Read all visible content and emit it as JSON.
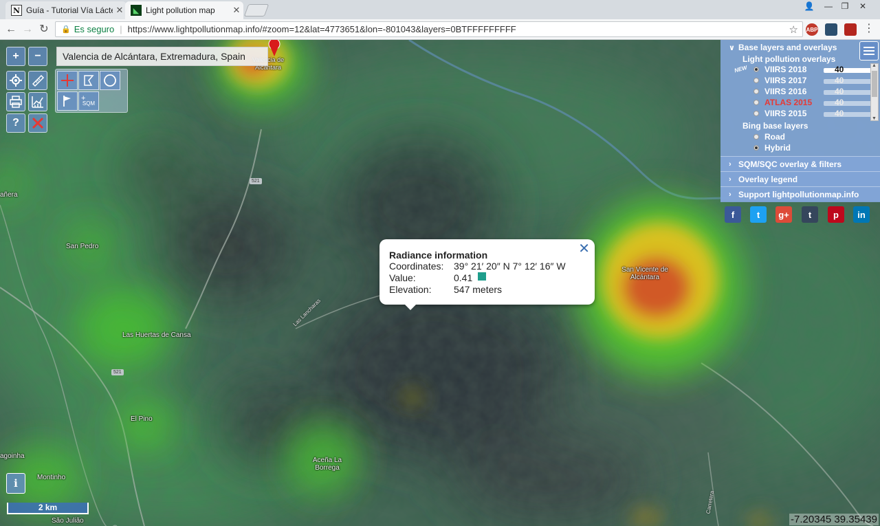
{
  "browser": {
    "tabs": [
      {
        "title": "Guía - Tutorial Vía Láctea",
        "favicon": "N"
      },
      {
        "title": "Light pollution map",
        "favicon": "lp"
      }
    ],
    "address": {
      "secure_label": "Es seguro",
      "url": "https://www.lightpollutionmap.info/#zoom=12&lat=4773651&lon=-801043&layers=0BTFFFFFFFFF"
    },
    "extensions": [
      {
        "label": "ABP",
        "color": "#c0392b"
      },
      {
        "label": "",
        "color": "#2c4f6e"
      },
      {
        "label": "",
        "color": "#b3261e"
      }
    ]
  },
  "map": {
    "search_text": "Valencia de Alcántara, Extremadura, Spain",
    "places": [
      {
        "name": "San Pedro"
      },
      {
        "name": "Las Huertas de Cansa"
      },
      {
        "name": "El Pino"
      },
      {
        "name": "Montinho"
      },
      {
        "name": "Aceña La Borrega"
      },
      {
        "name": "San Vicente de Alcántara"
      },
      {
        "name": "Las Lancharas"
      },
      {
        "name": "agoinha"
      },
      {
        "name": "añera"
      },
      {
        "name": "São Julião"
      },
      {
        "name": "Carretera"
      },
      {
        "name": "Valencia de Alcántara"
      }
    ],
    "road_shields": [
      "521",
      "521"
    ],
    "popup": {
      "title": "Radiance information",
      "coordinates_label": "Coordinates:",
      "coordinates_value": "39° 21′ 20″ N 7° 12′ 16″ W",
      "value_label": "Value:",
      "value_value": "0.41",
      "value_color": "#1f9e8c",
      "elevation_label": "Elevation:",
      "elevation_value": "547 meters"
    },
    "layer_panel": {
      "header": "Base layers and overlays",
      "overlays_title": "Light pollution overlays",
      "new_badge": "NEW",
      "overlays": [
        {
          "name": "VIIRS 2018",
          "selected": true,
          "opacity": "40"
        },
        {
          "name": "VIIRS 2017",
          "selected": false,
          "opacity": "40"
        },
        {
          "name": "VIIRS 2016",
          "selected": false,
          "opacity": "40"
        },
        {
          "name": "ATLAS 2015",
          "selected": false,
          "opacity": "40",
          "color": "#e53935"
        },
        {
          "name": "VIIRS 2015",
          "selected": false,
          "opacity": "40"
        }
      ],
      "base_title": "Bing base layers",
      "base_layers": [
        {
          "name": "Road",
          "selected": false
        },
        {
          "name": "Hybrid",
          "selected": true
        }
      ],
      "sections": [
        "SQM/SQC overlay & filters",
        "Overlay legend",
        "Support lightpollutionmap.info"
      ]
    },
    "social": [
      {
        "label": "f",
        "color": "#3b5998"
      },
      {
        "label": "t",
        "color": "#1da1f2"
      },
      {
        "label": "g+",
        "color": "#dd4b39"
      },
      {
        "label": "t",
        "color": "#35465c"
      },
      {
        "label": "p",
        "color": "#bd081c"
      },
      {
        "label": "in",
        "color": "#0077b5"
      }
    ],
    "controls": {
      "zoom_in": "+",
      "zoom_out": "−",
      "help": "?",
      "sqm_plus": "+",
      "sqm": "SQM",
      "info": "i"
    },
    "scale": "2 km",
    "cursor_coords": "-7.20345 39.35439"
  }
}
